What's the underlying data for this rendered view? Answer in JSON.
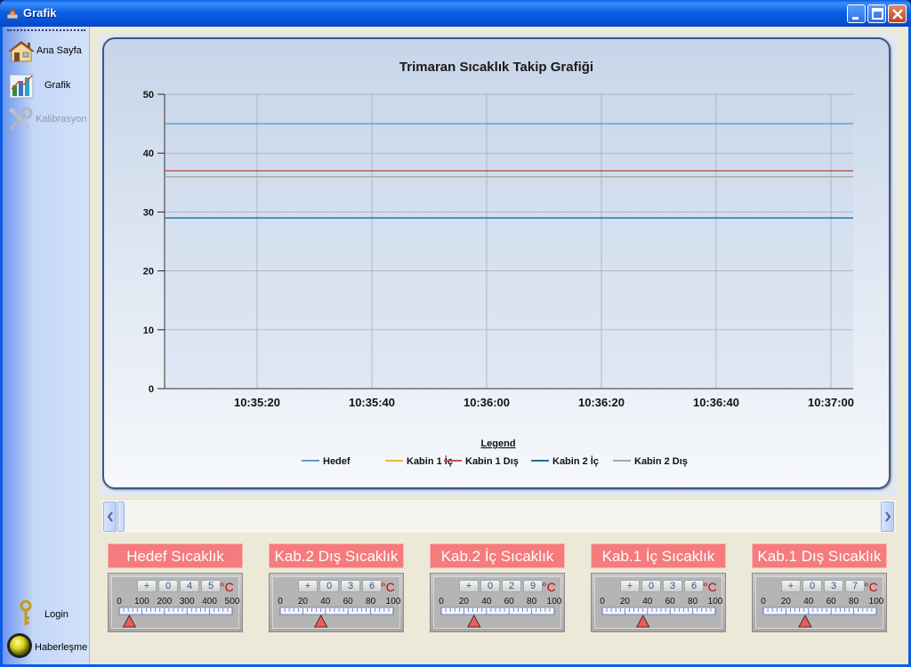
{
  "window": {
    "title": "Grafik"
  },
  "sidebar": {
    "items": [
      {
        "label": "Ana Sayfa",
        "icon": "house-icon",
        "enabled": true
      },
      {
        "label": "Grafik",
        "icon": "bar-chart-icon",
        "enabled": true
      },
      {
        "label": "Kalibrasyon",
        "icon": "tools-icon",
        "enabled": false
      }
    ],
    "login_label": "Login",
    "comm_label": "Haberleşme"
  },
  "chart_data": {
    "type": "line",
    "title": "Trimaran Sıcaklık Takip Grafiği",
    "xlabel": "",
    "ylabel": "",
    "ylim": [
      0,
      50
    ],
    "yticks": [
      0,
      10,
      20,
      30,
      40,
      50
    ],
    "xticks": [
      "10:35:20",
      "10:35:40",
      "10:36:00",
      "10:36:20",
      "10:36:40",
      "10:37:00"
    ],
    "grid": true,
    "legend_title": "Legend",
    "legend_position": "bottom",
    "series": [
      {
        "name": "Hedef",
        "color": "#5b9bd5",
        "values": [
          45,
          45
        ]
      },
      {
        "name": "Kabin 1 İç",
        "color": "#f2b33d",
        "values": []
      },
      {
        "name": "Kabin 1 Dış",
        "color": "#c0504d",
        "values": [
          37,
          37
        ]
      },
      {
        "name": "Kabin 2 İç",
        "color": "#1f6b9a",
        "values": [
          29,
          29
        ]
      },
      {
        "name": "Kabin 2 Dış",
        "color": "#a6a6a6",
        "values": [
          36,
          36
        ]
      }
    ]
  },
  "gauges": [
    {
      "title": "Hedef Sıcaklık",
      "sign": "+",
      "digits": [
        "0",
        "4",
        "5"
      ],
      "unit": "°C",
      "scale": [
        "0",
        "100",
        "200",
        "300",
        "400",
        "500"
      ],
      "max": 500,
      "value": 45
    },
    {
      "title": "Kab.2 Dış Sıcaklık",
      "sign": "+",
      "digits": [
        "0",
        "3",
        "6"
      ],
      "unit": "°C",
      "scale": [
        "0",
        "20",
        "40",
        "60",
        "80",
        "100"
      ],
      "max": 100,
      "value": 36
    },
    {
      "title": "Kab.2 İç Sıcaklık",
      "sign": "+",
      "digits": [
        "0",
        "2",
        "9"
      ],
      "unit": "°C",
      "scale": [
        "0",
        "20",
        "40",
        "60",
        "80",
        "100"
      ],
      "max": 100,
      "value": 29
    },
    {
      "title": "Kab.1 İç Sıcaklık",
      "sign": "+",
      "digits": [
        "0",
        "3",
        "6"
      ],
      "unit": "°C",
      "scale": [
        "0",
        "20",
        "40",
        "60",
        "80",
        "100"
      ],
      "max": 100,
      "value": 36
    },
    {
      "title": "Kab.1 Dış Sıcaklık",
      "sign": "+",
      "digits": [
        "0",
        "3",
        "7"
      ],
      "unit": "°C",
      "scale": [
        "0",
        "20",
        "40",
        "60",
        "80",
        "100"
      ],
      "max": 100,
      "value": 37
    }
  ]
}
